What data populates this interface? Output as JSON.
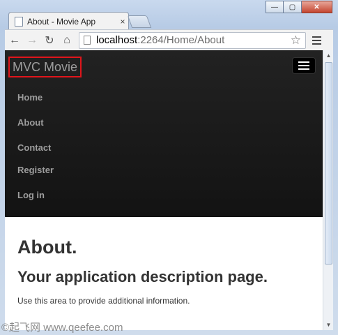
{
  "browser": {
    "tab_title": "About - Movie App",
    "tab_close": "×",
    "url_host": "localhost",
    "url_path": ":2264/Home/About",
    "window_controls": {
      "minimize": "—",
      "maximize": "▢",
      "close": "✕"
    }
  },
  "site": {
    "brand": "MVC Movie",
    "nav": [
      "Home",
      "About",
      "Contact"
    ],
    "auth": [
      "Register",
      "Log in"
    ]
  },
  "page": {
    "heading": "About.",
    "subheading": "Your application description page.",
    "body": "Use this area to provide additional information."
  },
  "watermark": "©起飞网  www.qeefee.com",
  "colors": {
    "navbar": "#1b1b1b",
    "brand_highlight": "#e0151b",
    "nav_text": "#9d9d9d"
  }
}
